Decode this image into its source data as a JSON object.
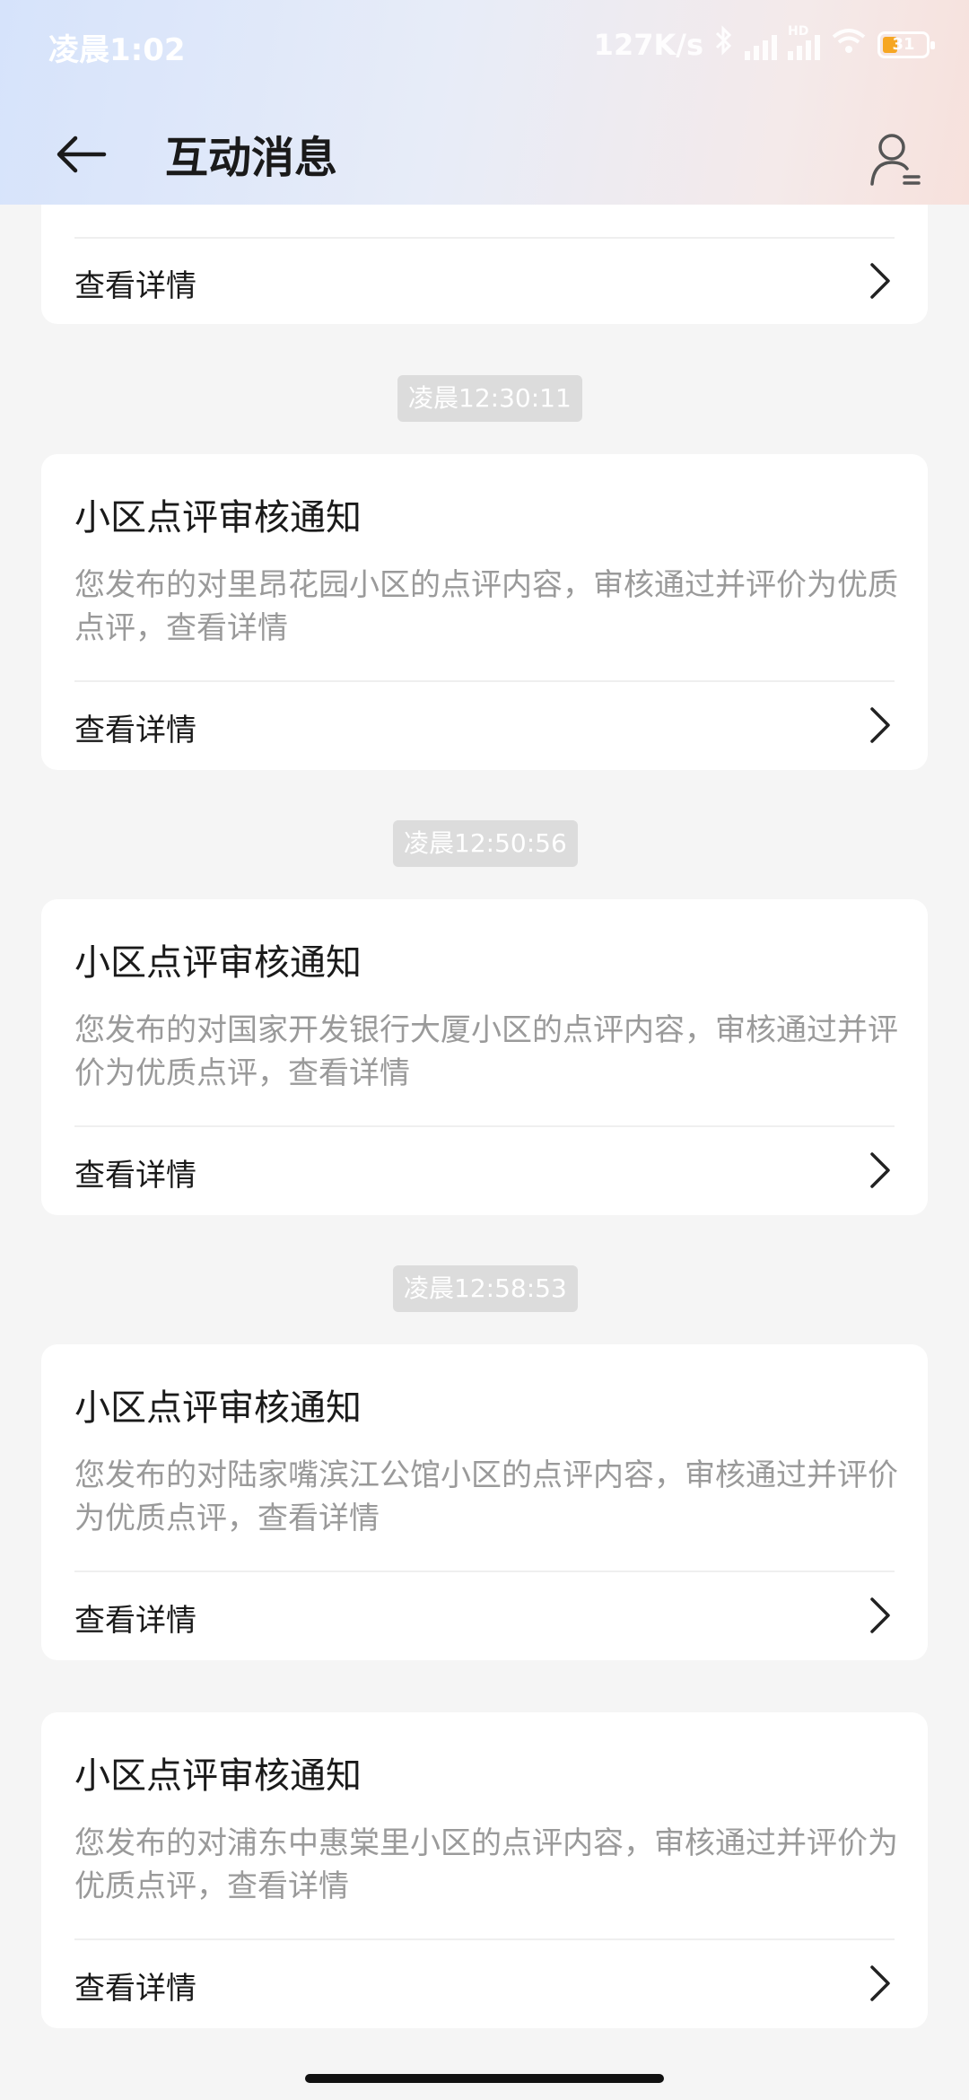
{
  "status_bar": {
    "time": "凌晨1:02",
    "net_speed": "127K/s",
    "battery": "31",
    "hd_label": "HD"
  },
  "nav": {
    "title": "互动消息",
    "back_icon": "arrow-left-icon",
    "profile_icon": "user-icon"
  },
  "partial_card": {
    "link_label": "查看详情"
  },
  "messages": [
    {
      "time": "凌晨12:30:11",
      "title": "小区点评审核通知",
      "desc": "您发布的对里昂花园小区的点评内容，审核通过并评价为优质点评，查看详情",
      "link_label": "查看详情"
    },
    {
      "time": "凌晨12:50:56",
      "title": "小区点评审核通知",
      "desc": "您发布的对国家开发银行大厦小区的点评内容，审核通过并评价为优质点评，查看详情",
      "link_label": "查看详情"
    },
    {
      "time": "凌晨12:58:53",
      "title": "小区点评审核通知",
      "desc": "您发布的对陆家嘴滨江公馆小区的点评内容，审核通过并评价为优质点评，查看详情",
      "link_label": "查看详情"
    },
    {
      "title": "小区点评审核通知",
      "desc": "您发布的对浦东中惠棠里小区的点评内容，审核通过并评价为优质点评，查看详情",
      "link_label": "查看详情"
    }
  ]
}
